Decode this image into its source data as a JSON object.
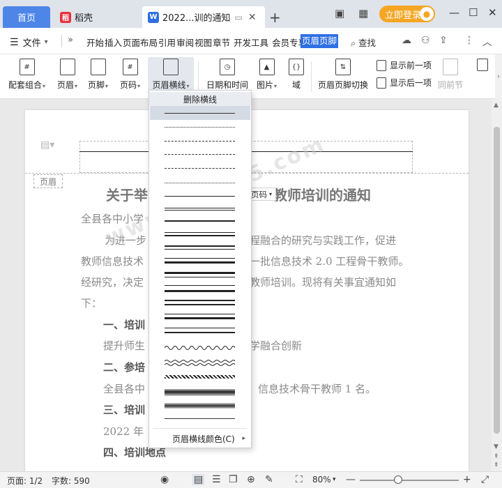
{
  "titlebar": {
    "home_tab": "首页",
    "daoke_tab": "稻壳",
    "doc_tab": "2022...训的通知",
    "login": "立即登录"
  },
  "menu": {
    "file": "文件",
    "items": [
      "开始",
      "插入",
      "页面布局",
      "引用",
      "审阅",
      "视图",
      "章节",
      "开发工具",
      "会员专享"
    ],
    "active": "页眉页脚",
    "search": "查找"
  },
  "ribbon": {
    "tools": [
      {
        "label": "配套组合",
        "glyph": "#"
      },
      {
        "label": "页眉",
        "glyph": ""
      },
      {
        "label": "页脚",
        "glyph": ""
      },
      {
        "label": "页码",
        "glyph": "#"
      },
      {
        "label": "页眉横线",
        "glyph": ""
      },
      {
        "label": "日期和时间",
        "glyph": "◷"
      },
      {
        "label": "图片",
        "glyph": "▲"
      },
      {
        "label": "域",
        "glyph": "{}"
      },
      {
        "label": "页眉页脚切换",
        "glyph": "⇅"
      }
    ],
    "show_prev": "显示前一项",
    "show_next": "显示后一项",
    "same_as_prev": "同前节"
  },
  "dropdown": {
    "delete_label": "删除横线",
    "color_label": "页眉横线颜色(C)"
  },
  "document": {
    "header_tag": "页眉",
    "page_num_button": "页码",
    "title_left": "关于举",
    "title_right": "教师培训的通知",
    "watermark": "www.admin5.com",
    "lines": [
      {
        "left": "全县各中小学",
        "right": ""
      },
      {
        "left": "为进一步",
        "right": "程融合的研究与实践工作，促进"
      },
      {
        "left": "教师信息技术",
        "right": "一批信息技术 2.0 工程骨干教师。"
      },
      {
        "left": "经研究，决定",
        "right": "教师培训。现将有关事宜通知如"
      },
      {
        "left": "下：",
        "right": ""
      },
      {
        "left": "一、培训",
        "right": ""
      },
      {
        "left": "提升师生",
        "right": "学融合创新"
      },
      {
        "left": "二、参培",
        "right": ""
      },
      {
        "left": "全县各中",
        "right": "信息技术骨干教师 1 名。"
      },
      {
        "left": "三、培训",
        "right": ""
      },
      {
        "left": "2022 年 1",
        "right": ""
      },
      {
        "left": "四、培训地点",
        "right": ""
      }
    ]
  },
  "status": {
    "page": "页面: 1/2",
    "words": "字数: 590",
    "zoom": "80%"
  }
}
